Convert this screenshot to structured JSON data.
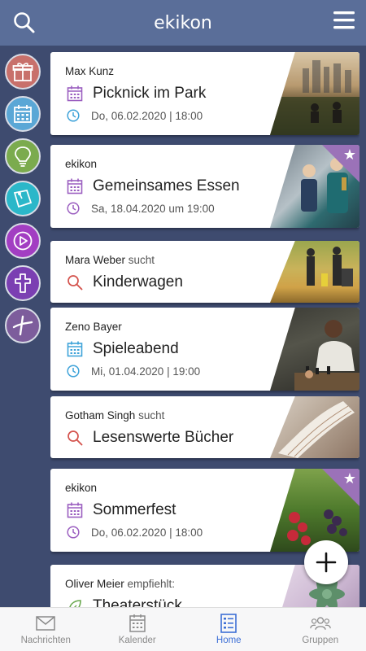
{
  "app": {
    "title": "ekikon"
  },
  "cards": [
    {
      "author": "Max Kunz",
      "suffix": "",
      "title": "Picknick im Park",
      "title_icon": "calendar-icon",
      "datetime": "Do, 06.02.2020 | 18:00",
      "star": false
    },
    {
      "author": "ekikon",
      "suffix": "",
      "title": "Gemeinsames Essen",
      "title_icon": "calendar-icon",
      "datetime": "Sa, 18.04.2020 um 19:00",
      "star": true
    },
    {
      "author": "Mara Weber",
      "suffix": " sucht",
      "title": "Kinderwagen",
      "title_icon": "search-icon",
      "datetime": "",
      "star": false
    },
    {
      "author": "Zeno Bayer",
      "suffix": "",
      "title": "Spieleabend",
      "title_icon": "calendar-icon",
      "datetime": "Mi, 01.04.2020 | 19:00",
      "star": false
    },
    {
      "author": "Gotham Singh",
      "suffix": " sucht",
      "title": "Lesenswerte Bücher",
      "title_icon": "search-icon",
      "datetime": "",
      "star": false
    },
    {
      "author": "ekikon",
      "suffix": "",
      "title": "Sommerfest",
      "title_icon": "calendar-icon",
      "datetime": "Do, 06.02.2020 | 18:00",
      "star": true
    },
    {
      "author": "Oliver Meier",
      "suffix": " empfiehlt:",
      "title": "Theaterstück",
      "title_icon": "leaf-icon",
      "datetime": "",
      "star": false
    }
  ],
  "nav": {
    "messages": "Nachrichten",
    "calendar": "Kalender",
    "home": "Home",
    "groups": "Gruppen"
  },
  "colors": {
    "header": "#5a6e99",
    "background": "#3e4b6f",
    "accent_blue": "#3fa3d9",
    "accent_purple": "#9b5fc0",
    "nav_active": "#3d6fd6"
  }
}
